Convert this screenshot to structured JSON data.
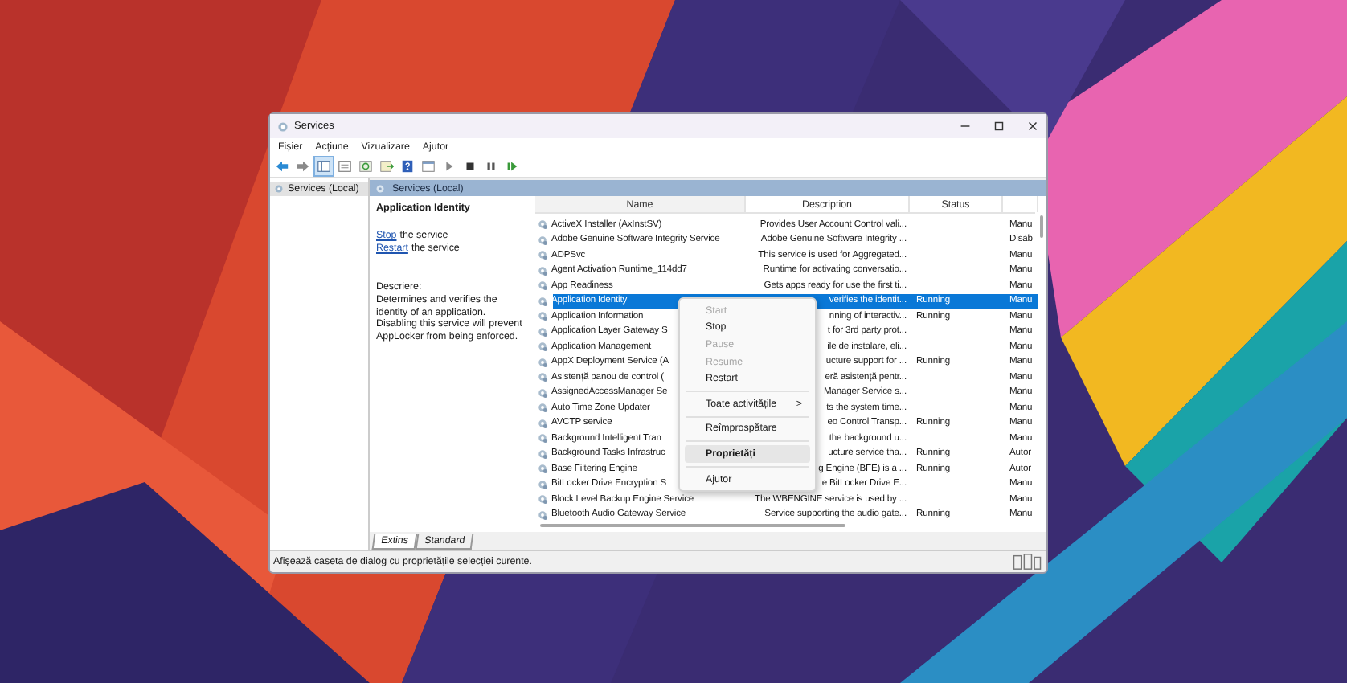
{
  "window": {
    "title": "Services"
  },
  "menu": [
    "Fișier",
    "Acțiune",
    "Vizualizare",
    "Ajutor"
  ],
  "tree": [
    {
      "label": "Services (Local)",
      "selected": true
    }
  ],
  "pane_title": "Services (Local)",
  "info": {
    "title": "Application Identity",
    "actions": [
      {
        "link": "Stop",
        "text": "the service"
      },
      {
        "link": "Restart",
        "text": "the service"
      }
    ],
    "description_label": "Descriere:",
    "description": "Determines and verifies the identity of an application. Disabling this service will prevent AppLocker from being enforced."
  },
  "columns": [
    "Name",
    "Description",
    "Status"
  ],
  "rows": [
    {
      "name": "ActiveX Installer (AxInstSV)",
      "description": "Provides User Account Control vali...",
      "status": "",
      "startup": "Manu",
      "selected": false
    },
    {
      "name": "Adobe Genuine Software Integrity Service",
      "description": "Adobe Genuine Software Integrity ...",
      "status": "",
      "startup": "Disab",
      "selected": false
    },
    {
      "name": "ADPSvc",
      "description": "This service is used for Aggregated...",
      "status": "",
      "startup": "Manu",
      "selected": false
    },
    {
      "name": "Agent Activation Runtime_114dd7",
      "description": "Runtime for activating conversatio...",
      "status": "",
      "startup": "Manu",
      "selected": false
    },
    {
      "name": "App Readiness",
      "description": "Gets apps ready for use the first ti...",
      "status": "",
      "startup": "Manu",
      "selected": false
    },
    {
      "name": "Application Identity",
      "description": "verifies the identit...",
      "status": "Running",
      "startup": "Manu",
      "selected": true
    },
    {
      "name": "Application Information",
      "description": "nning of interactiv...",
      "status": "Running",
      "startup": "Manu",
      "selected": false
    },
    {
      "name": "Application Layer Gateway S",
      "description": "t for 3rd party prot...",
      "status": "",
      "startup": "Manu",
      "selected": false
    },
    {
      "name": "Application Management",
      "description": "ile de instalare, eli...",
      "status": "",
      "startup": "Manu",
      "selected": false
    },
    {
      "name": "AppX Deployment Service (A",
      "description": "ucture support for ...",
      "status": "Running",
      "startup": "Manu",
      "selected": false
    },
    {
      "name": "Asistență panou de control (",
      "description": "eră asistență pentr...",
      "status": "",
      "startup": "Manu",
      "selected": false
    },
    {
      "name": "AssignedAccessManager Se",
      "description": "Manager Service s...",
      "status": "",
      "startup": "Manu",
      "selected": false
    },
    {
      "name": "Auto Time Zone Updater",
      "description": "ts the system time...",
      "status": "",
      "startup": "Manu",
      "selected": false
    },
    {
      "name": "AVCTP service",
      "description": "eo Control Transp...",
      "status": "Running",
      "startup": "Manu",
      "selected": false
    },
    {
      "name": "Background Intelligent Tran",
      "description": "the background u...",
      "status": "",
      "startup": "Manu",
      "selected": false
    },
    {
      "name": "Background Tasks Infrastruc",
      "description": "ucture service tha...",
      "status": "Running",
      "startup": "Autor",
      "selected": false
    },
    {
      "name": "Base Filtering Engine",
      "description": "g Engine (BFE) is a ...",
      "status": "Running",
      "startup": "Autor",
      "selected": false
    },
    {
      "name": "BitLocker Drive Encryption S",
      "description": "e BitLocker Drive E...",
      "status": "",
      "startup": "Manu",
      "selected": false
    },
    {
      "name": "Block Level Backup Engine Service",
      "description": "The WBENGINE service is used by ...",
      "status": "",
      "startup": "Manu",
      "selected": false
    },
    {
      "name": "Bluetooth Audio Gateway Service",
      "description": "Service supporting the audio gate...",
      "status": "Running",
      "startup": "Manu",
      "selected": false
    }
  ],
  "context_menu": [
    {
      "kind": "item",
      "label": "Start",
      "disabled": true,
      "default": false,
      "selected": false
    },
    {
      "kind": "item",
      "label": "Stop",
      "disabled": false,
      "default": false,
      "selected": false
    },
    {
      "kind": "item",
      "label": "Pause",
      "disabled": true,
      "default": false,
      "selected": false
    },
    {
      "kind": "item",
      "label": "Resume",
      "disabled": true,
      "default": false,
      "selected": false
    },
    {
      "kind": "item",
      "label": "Restart",
      "disabled": false,
      "default": false,
      "selected": false
    },
    {
      "kind": "separator"
    },
    {
      "kind": "submenu",
      "label": "Toate activitățile",
      "arrow": ">",
      "disabled": false,
      "default": false,
      "selected": false
    },
    {
      "kind": "separator"
    },
    {
      "kind": "item",
      "label": "Reîmprospătare",
      "disabled": false,
      "default": false,
      "selected": false
    },
    {
      "kind": "separator"
    },
    {
      "kind": "item",
      "label": "Proprietăți",
      "disabled": false,
      "default": true,
      "selected": true
    },
    {
      "kind": "separator"
    },
    {
      "kind": "item",
      "label": "Ajutor",
      "disabled": false,
      "default": false,
      "selected": false
    }
  ],
  "tabs": [
    {
      "label": "Extins",
      "selected": true
    },
    {
      "label": "Standard",
      "selected": false
    }
  ],
  "status_bar": "Afișează caseta de dialog cu proprietățile selecției curente."
}
